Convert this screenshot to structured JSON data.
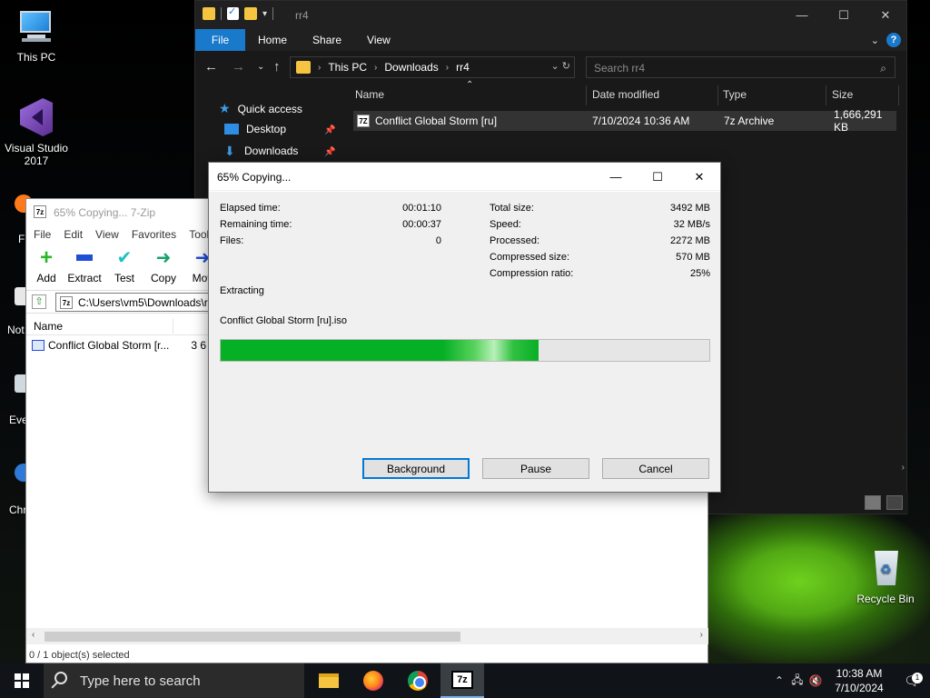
{
  "desktop": {
    "icons": [
      {
        "label": "This PC"
      },
      {
        "label": "Visual Studio 2017"
      },
      {
        "label": "Recycle Bin"
      }
    ],
    "partial_labels": [
      "Fi",
      "Not",
      "Eve",
      "Chr"
    ]
  },
  "explorer": {
    "title": "rr4",
    "controls": {
      "minimize": "—",
      "maximize": "☐",
      "close": "✕"
    },
    "ribbon_tabs": [
      "File",
      "Home",
      "Share",
      "View"
    ],
    "breadcrumb": [
      "This PC",
      "Downloads",
      "rr4"
    ],
    "search_placeholder": "Search rr4",
    "nav_items": [
      "Quick access",
      "Desktop",
      "Downloads"
    ],
    "columns": [
      "Name",
      "Date modified",
      "Type",
      "Size"
    ],
    "files": [
      {
        "name": "Conflict Global Storm [ru]",
        "date": "7/10/2024 10:36 AM",
        "type": "7z Archive",
        "size": "1,666,291 KB"
      }
    ]
  },
  "sevenzip": {
    "title": "65% Copying... 7-Zip",
    "menu": [
      "File",
      "Edit",
      "View",
      "Favorites",
      "Tools"
    ],
    "toolbar": [
      "Add",
      "Extract",
      "Test",
      "Copy",
      "Mov"
    ],
    "path": "C:\\Users\\vm5\\Downloads\\r",
    "list_header": "Name",
    "rows": [
      {
        "name": "Conflict Global Storm [r...",
        "size": "3 6"
      }
    ],
    "status": "0 / 1 object(s) selected"
  },
  "dialog": {
    "title": "65% Copying...",
    "controls": {
      "minimize": "—",
      "maximize": "☐",
      "close": "✕"
    },
    "left": [
      {
        "label": "Elapsed time:",
        "value": "00:01:10"
      },
      {
        "label": "Remaining time:",
        "value": "00:00:37"
      },
      {
        "label": "Files:",
        "value": "0"
      }
    ],
    "right": [
      {
        "label": "Total size:",
        "value": "3492 MB"
      },
      {
        "label": "Speed:",
        "value": "32 MB/s"
      },
      {
        "label": "Processed:",
        "value": "2272 MB"
      },
      {
        "label": "Compressed size:",
        "value": "570 MB"
      },
      {
        "label": "Compression ratio:",
        "value": "25%"
      }
    ],
    "operation": "Extracting",
    "current_file": "Conflict Global Storm [ru].iso",
    "progress_percent": 65,
    "buttons": {
      "background": "Background",
      "pause": "Pause",
      "cancel": "Cancel"
    }
  },
  "taskbar": {
    "search_placeholder": "Type here to search",
    "time": "10:38 AM",
    "date": "7/10/2024",
    "notification_count": "1",
    "seven_zip_label": "7z"
  },
  "colors": {
    "progress_green": "#06b025",
    "accent_blue": "#1979ca",
    "explorer_bg": "#191919"
  }
}
